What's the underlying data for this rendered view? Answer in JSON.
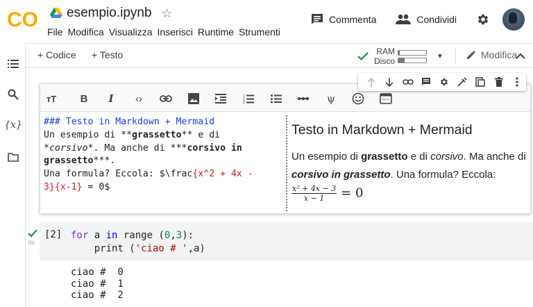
{
  "header": {
    "logo_text": "CO",
    "doc_title": "esempio.ipynb",
    "menu": [
      "File",
      "Modifica",
      "Visualizza",
      "Inserisci",
      "Runtime",
      "Strumenti"
    ],
    "comment_label": "Commenta",
    "share_label": "Condividi"
  },
  "toolbar": {
    "add_code": "+ Codice",
    "add_text": "+ Testo",
    "ram_label": "RAM",
    "disk_label": "Disco",
    "ram_usage": 0.05,
    "disk_usage": 0.22,
    "edit_label": "Modifica"
  },
  "textcell": {
    "editor_lines": {
      "l1": "### Testo in Markdown + Mermaid",
      "l2a": "Un esempio di **",
      "l2b": "grassetto",
      "l2c": "** e di",
      "l3a": "*",
      "l3b": "corsivo",
      "l3c": "*. Ma anche di ***",
      "l3d": "corsivo in",
      "l4a": "grassetto",
      "l4b": "***.",
      "l5a": "Una formula? Eccola: $\\frac",
      "l5b": "{x^2 + 4x -",
      "l6a": "3}{x-1}",
      "l6b": " = 0$"
    },
    "preview": {
      "heading": "Testo in Markdown + Mermaid",
      "p1": "Un esempio di ",
      "bold": "grassetto",
      "p2": " e di ",
      "italic": "corsivo",
      "p3": ". Ma anche di ",
      "bolditalic": "corsivo in grassetto",
      "p4": ". Una formula? Eccola:",
      "formula_num": "x² + 4x − 3",
      "formula_den": "x − 1",
      "formula_rhs": "= 0"
    }
  },
  "codecell": {
    "exec_count": "[2]",
    "exec_time": "0s",
    "code": {
      "for": "for",
      "a1": " a ",
      "in": "in",
      "range": " range (",
      "n0": "0",
      "comma": ",",
      "n3": "3",
      "close": "):",
      "print": "    print (",
      "str": "'ciao # '",
      "rest": ",a)"
    },
    "output": [
      "ciao #  0",
      "ciao #  1",
      "ciao #  2"
    ]
  }
}
